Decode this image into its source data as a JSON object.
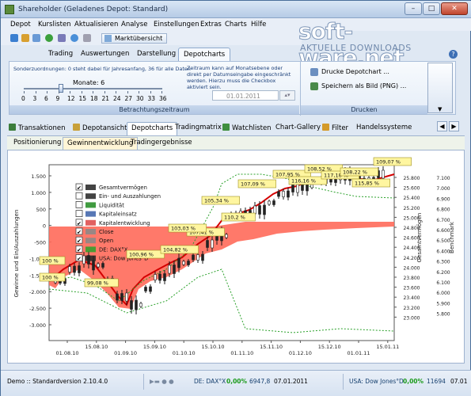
{
  "window": {
    "title": "Shareholder (Geladenes Depot: Standard)",
    "btn_min": "–",
    "btn_max": "□",
    "btn_close": "✕"
  },
  "watermark": {
    "brand": "soft-ware.net",
    "tagline": "AKTUELLE DOWNLOADS"
  },
  "menu": [
    "Depot",
    "Kurslisten",
    "Aktualisieren",
    "Analyse",
    "Einstellungen",
    "Extras",
    "Charts",
    "Hilfe"
  ],
  "toolbar": {
    "market_button": "Marktübersicht"
  },
  "ribbon_tabs": [
    "Trading",
    "Auswertungen",
    "Darstellung",
    "Depotcharts"
  ],
  "ribbon": {
    "sonder_text": "Sonderzuordnungen: 0 steht dabei für Jahresanfang, 36 für alle Daten",
    "months_label": "Monate: 6",
    "months_value": 6,
    "ticks": [
      "0",
      "3",
      "6",
      "9",
      "12",
      "15",
      "18",
      "21",
      "24",
      "27",
      "30",
      "33",
      "36"
    ],
    "zeitraum_text": "Zeitraum kann auf Monatsebene oder direkt per Datumseingabe eingeschränkt werden. Hierzu muss die Checkbox aktiviert sein.",
    "date_value": "01.01.2011",
    "group_range": "Betrachtungszeitraum",
    "print_label": "Drucke Depotchart ...",
    "save_label": "Speichern als Bild (PNG) ...",
    "group_print": "Drucken"
  },
  "subtabs": [
    "Transaktionen",
    "Depotansicht",
    "Depotcharts",
    "Tradingmatrix",
    "Watchlisten",
    "Chart-Gallery",
    "Filter",
    "Handelssysteme"
  ],
  "chart_tabs": [
    "Positionierung",
    "Gewinnentwicklung",
    "Tradingergebnisse"
  ],
  "status": {
    "demo": "Demo :: Standardversion 2.10.4.0",
    "idx1": "DE: DAX°X",
    "idx1_pct": "0,00%",
    "idx1_val": "6947,8",
    "idx1_date": "07.01.2011",
    "idx2": "USA: Dow Jones°D",
    "idx2_pct": "0,00%",
    "idx2_val": "11694",
    "idx2_date": "07.01"
  },
  "chart_data": {
    "type": "line",
    "ylabel_left": "Gewinne und Ein/Auszahlungen",
    "ylabel_right1": "Gesamtvermögen",
    "ylabel_right2": "Benchmark",
    "yleft_ticks": [
      "1.500",
      "1.000",
      "500",
      "0",
      "-500",
      "-1.000",
      "-1.500",
      "-2.000",
      "-2.500",
      "-3.000"
    ],
    "yright1_ticks": [
      "25.000",
      "24.800",
      "24.600",
      "24.400",
      "24.200",
      "24.000",
      "23.800",
      "23.600",
      "23.400",
      "23.200",
      "23.000"
    ],
    "yright2_ticks": [
      "7.100",
      "7.000",
      "6.900",
      "6.800",
      "6.700",
      "6.600",
      "6.500",
      "6.400",
      "6.300",
      "6.200",
      "6.100",
      "6.000",
      "5.900",
      "5.800"
    ],
    "yright1_ticks_top": [
      "25.800",
      "25.600",
      "25.400",
      "25.200"
    ],
    "x_ticks": [
      "01.08.10",
      "15.08.10",
      "01.09.10",
      "15.09.10",
      "01.10.10",
      "15.10.10",
      "01.11.10",
      "15.11.10",
      "01.12.10",
      "15.12.10",
      "01.01.11",
      "15.01.11"
    ],
    "legend": [
      {
        "label": "Gesamtvermögen",
        "checked": true
      },
      {
        "label": "Ein- und Auszahlungen",
        "checked": false
      },
      {
        "label": "Liquidität",
        "checked": false
      },
      {
        "label": "Kapitaleinsatz",
        "checked": false
      },
      {
        "label": "Kapitalentwicklung",
        "checked": true
      },
      {
        "label": "Close",
        "checked": true
      },
      {
        "label": "Open",
        "checked": true
      },
      {
        "label": "DE: DAX°X",
        "checked": true
      },
      {
        "label": "USA: Dow Jones°D",
        "checked": true
      }
    ],
    "annotations": [
      "100 %",
      "100 %",
      "99,08 %",
      "100,96 %",
      "104,82 %",
      "107,41 %",
      "103,03 %",
      "105,34 %",
      "110,2 %",
      "107,09 %",
      "107,95 %",
      "116,16 %",
      "108,52 %",
      "117,18 %",
      "108,22 %",
      "115,85 %",
      "109,07 %"
    ],
    "colors": {
      "capital": "#ff6a5a",
      "total": "#d40000",
      "dax": "#2aa12a",
      "dow": "#1a1a1a",
      "label_bg": "#fff6a0"
    }
  }
}
